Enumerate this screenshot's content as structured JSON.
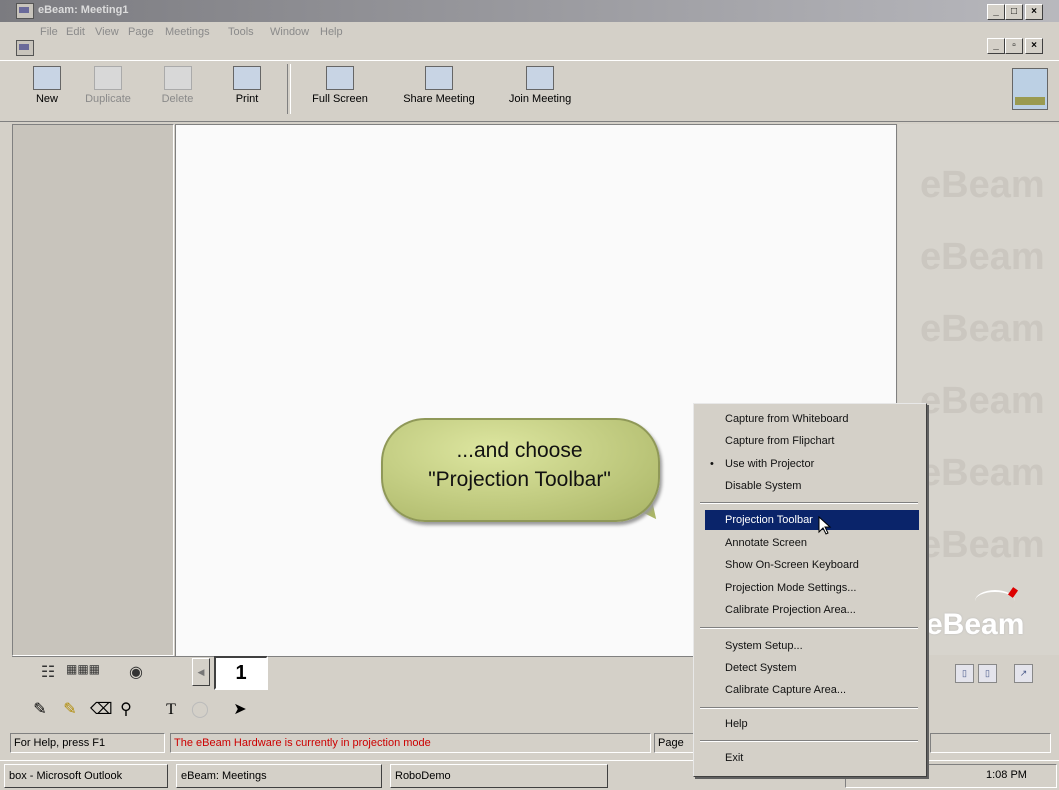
{
  "window": {
    "title": "eBeam: Meeting1",
    "controls": [
      "_",
      "□",
      "×"
    ],
    "doc_controls": [
      "_",
      "▫",
      "×"
    ]
  },
  "menu": [
    "File",
    "Edit",
    "View",
    "Page",
    "Meetings",
    "Tools",
    "Window",
    "Help"
  ],
  "toolbar": {
    "new": "New",
    "duplicate": "Duplicate",
    "delete": "Delete",
    "print": "Print",
    "full_screen": "Full Screen",
    "share_meeting": "Share Meeting",
    "join_meeting": "Join Meeting"
  },
  "callout": {
    "line1": "...and choose",
    "line2": "\"Projection Toolbar\""
  },
  "brand": "eBeam",
  "watermark": "eBeam",
  "page_number": "1",
  "context_menu": {
    "items": [
      "Capture from Whiteboard",
      "Capture from Flipchart",
      "Use with Projector",
      "Disable System",
      "Projection Toolbar",
      "Annotate Screen",
      "Show On-Screen Keyboard",
      "Projection Mode Settings...",
      "Calibrate Projection Area...",
      "System Setup...",
      "Detect System",
      "Calibrate Capture Area...",
      "Help",
      "Exit"
    ]
  },
  "status": {
    "help": "For Help, press F1",
    "message": "The eBeam Hardware is currently in projection mode",
    "page": "Page"
  },
  "taskbar": {
    "tasks": [
      "box - Microsoft Outlook",
      "eBeam: Meetings",
      "RoboDemo"
    ],
    "clock": "1:08 PM"
  },
  "colors": {
    "highlight": "#0a246a",
    "status_message": "#cc0000",
    "callout": "#c6d07f"
  }
}
